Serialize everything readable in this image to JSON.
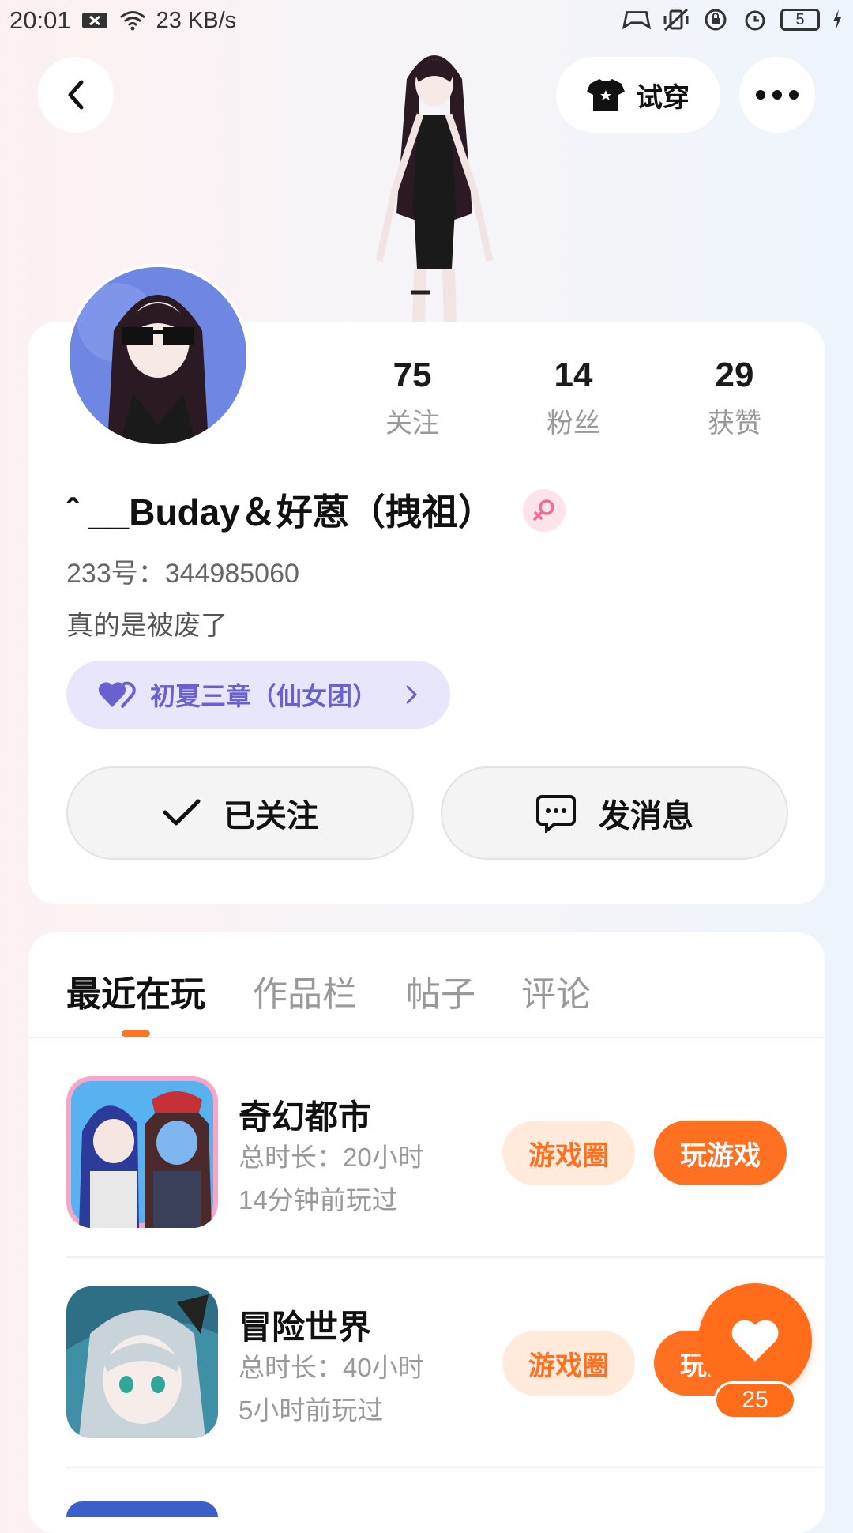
{
  "status_bar": {
    "time": "20:01",
    "speed": "23 KB/s",
    "battery": "5"
  },
  "header": {
    "tryon_label": "试穿"
  },
  "stats": [
    {
      "value": "75",
      "label": "关注"
    },
    {
      "value": "14",
      "label": "粉丝"
    },
    {
      "value": "29",
      "label": "获赞"
    }
  ],
  "profile": {
    "username": "ˆ __Buday＆好蒽（拽祖）",
    "id_line": "233号：344985060",
    "bio": "真的是被废了",
    "group_label": "初夏三章（仙女团）",
    "follow_label": "已关注",
    "message_label": "发消息"
  },
  "tabs": [
    {
      "label": "最近在玩"
    },
    {
      "label": "作品栏"
    },
    {
      "label": "帖子"
    },
    {
      "label": "评论"
    }
  ],
  "games": [
    {
      "title": "奇幻都市",
      "duration": "总时长：20小时",
      "last_played": "14分钟前玩过",
      "circle_label": "游戏圈",
      "play_label": "玩游戏"
    },
    {
      "title": "冒险世界",
      "duration": "总时长：40小时",
      "last_played": "5小时前玩过",
      "circle_label": "游戏圈",
      "play_label": "玩游戏"
    }
  ],
  "fab": {
    "count": "25"
  },
  "colors": {
    "accent": "#ff7020",
    "group_bg": "#e8e6fb",
    "group_text": "#6a60cf"
  }
}
